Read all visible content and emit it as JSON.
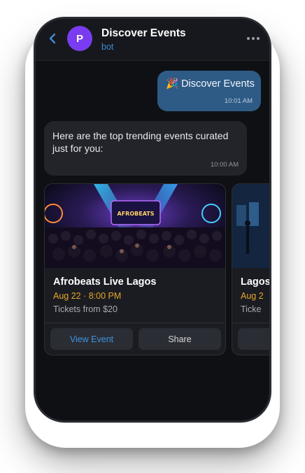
{
  "header": {
    "avatar_letter": "P",
    "title": "Discover Events",
    "subtitle": "bot"
  },
  "messages": {
    "outgoing": {
      "text": "🎉 Discover Events",
      "time": "10:01 AM"
    },
    "incoming": {
      "text": "Here are the top trending events curated just for you:",
      "time": "10:00 AM"
    }
  },
  "cards": [
    {
      "title": "Afrobeats Live Lagos",
      "date": "Aug 22 · 8:00 PM",
      "price": "Tickets from $20",
      "view_label": "View Event",
      "share_label": "Share",
      "stage_sign": "AFROBEATS"
    },
    {
      "title": "Lagos",
      "date": "Aug 2",
      "price": "Ticke"
    }
  ],
  "colors": {
    "accent": "#3d8cd6",
    "avatar": "#7a3cf0",
    "date": "#e5a62a",
    "outgoing_bubble": "#2e5b85"
  },
  "icons": {
    "back": "chevron-left-icon",
    "more": "more-horizontal-icon"
  }
}
